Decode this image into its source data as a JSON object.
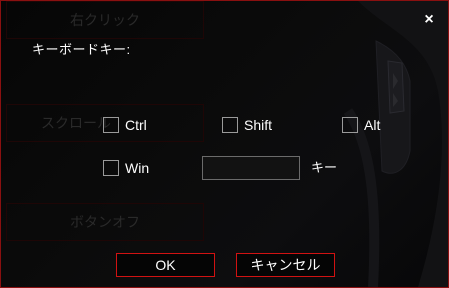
{
  "background": {
    "right_click_label": "右クリック",
    "scroll_label": "スクロール",
    "button_off_label": "ボタンオフ"
  },
  "dialog": {
    "close_glyph": "×",
    "title": "キーボードキー:",
    "modifiers": {
      "ctrl": {
        "label": "Ctrl",
        "checked": false
      },
      "shift": {
        "label": "Shift",
        "checked": false
      },
      "alt": {
        "label": "Alt",
        "checked": false
      },
      "win": {
        "label": "Win",
        "checked": false
      }
    },
    "key_input": {
      "value": "",
      "placeholder": ""
    },
    "key_label": "キー",
    "ok_label": "OK",
    "cancel_label": "キャンセル"
  },
  "colors": {
    "accent": "#d11212",
    "background": "#0a0a0a",
    "text": "#ffffff"
  }
}
